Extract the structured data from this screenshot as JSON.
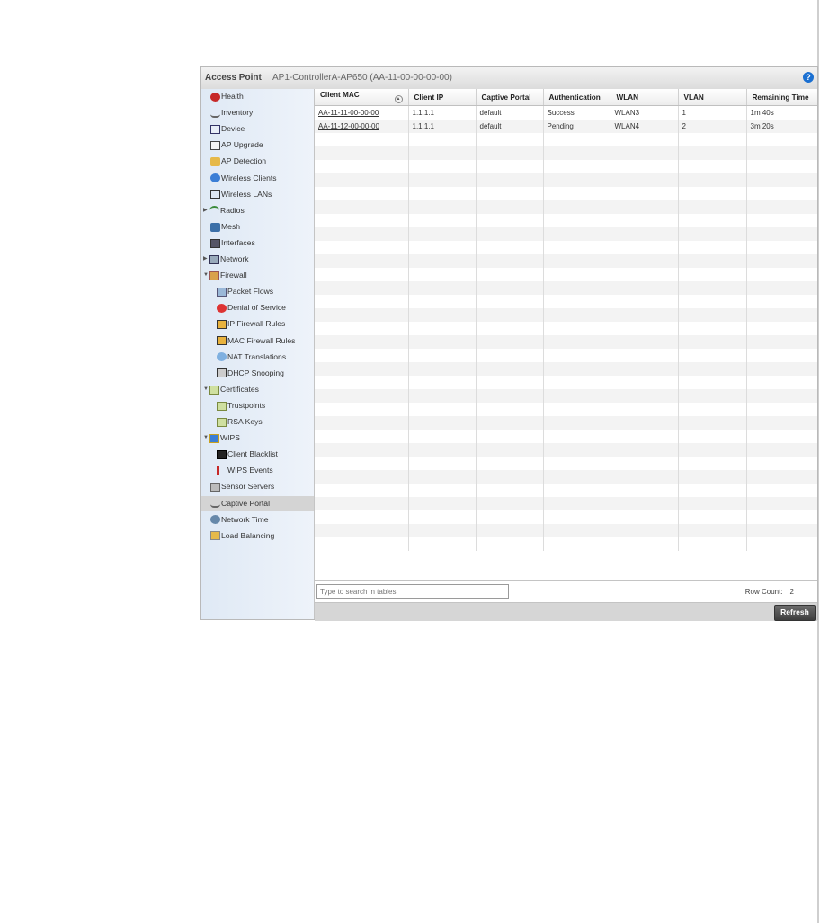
{
  "header": {
    "title": "Access Point",
    "subtitle": "AP1-ControllerA-AP650 (AA-11-00-00-00-00)",
    "help": "?"
  },
  "sidebar": {
    "items": [
      {
        "label": "Health",
        "icon": "health-icon",
        "indent": 0
      },
      {
        "label": "Inventory",
        "icon": "inventory-icon",
        "indent": 0
      },
      {
        "label": "Device",
        "icon": "device-icon",
        "indent": 0
      },
      {
        "label": "AP Upgrade",
        "icon": "ap-upgrade-icon",
        "indent": 0
      },
      {
        "label": "AP Detection",
        "icon": "ap-detection-icon",
        "indent": 0
      },
      {
        "label": "Wireless Clients",
        "icon": "wireless-clients-icon",
        "indent": 0
      },
      {
        "label": "Wireless LANs",
        "icon": "wireless-lans-icon",
        "indent": 0
      },
      {
        "label": "Radios",
        "icon": "radios-icon",
        "indent": 0,
        "arrow": "▶"
      },
      {
        "label": "Mesh",
        "icon": "mesh-icon",
        "indent": 0
      },
      {
        "label": "Interfaces",
        "icon": "interfaces-icon",
        "indent": 0
      },
      {
        "label": "Network",
        "icon": "network-icon",
        "indent": 0,
        "arrow": "▶"
      },
      {
        "label": "Firewall",
        "icon": "firewall-icon",
        "indent": 0,
        "arrow": "▼"
      },
      {
        "label": "Packet Flows",
        "icon": "packet-flows-icon",
        "indent": 1
      },
      {
        "label": "Denial of Service",
        "icon": "denial-of-service-icon",
        "indent": 1
      },
      {
        "label": "IP Firewall Rules",
        "icon": "ip-firewall-rules-icon",
        "indent": 1
      },
      {
        "label": "MAC Firewall Rules",
        "icon": "mac-firewall-rules-icon",
        "indent": 1
      },
      {
        "label": "NAT Translations",
        "icon": "nat-translations-icon",
        "indent": 1
      },
      {
        "label": "DHCP Snooping",
        "icon": "dhcp-snooping-icon",
        "indent": 1
      },
      {
        "label": "Certificates",
        "icon": "certificates-icon",
        "indent": 0,
        "arrow": "▼"
      },
      {
        "label": "Trustpoints",
        "icon": "trustpoints-icon",
        "indent": 1
      },
      {
        "label": "RSA Keys",
        "icon": "rsa-keys-icon",
        "indent": 1
      },
      {
        "label": "WIPS",
        "icon": "wips-icon",
        "indent": 0,
        "arrow": "▼"
      },
      {
        "label": "Client Blacklist",
        "icon": "client-blacklist-icon",
        "indent": 1
      },
      {
        "label": "WIPS Events",
        "icon": "wips-events-icon",
        "indent": 1
      },
      {
        "label": "Sensor Servers",
        "icon": "sensor-servers-icon",
        "indent": 0
      },
      {
        "label": "Captive Portal",
        "icon": "captive-portal-icon",
        "indent": 0,
        "active": true
      },
      {
        "label": "Network Time",
        "icon": "network-time-icon",
        "indent": 0
      },
      {
        "label": "Load Balancing",
        "icon": "load-balancing-icon",
        "indent": 0
      }
    ]
  },
  "table": {
    "columns": [
      "Client MAC",
      "Client IP",
      "Captive Portal",
      "Authentication",
      "WLAN",
      "VLAN",
      "Remaining Time"
    ],
    "rows": [
      [
        "AA-11-11-00-00-00",
        "1.1.1.1",
        "default",
        "Success",
        "WLAN3",
        "1",
        "1m 40s"
      ],
      [
        "AA-11-12-00-00-00",
        "1.1.1.1",
        "default",
        "Pending",
        "WLAN4",
        "2",
        "3m 20s"
      ]
    ]
  },
  "footer": {
    "search_placeholder": "Type to search in tables",
    "row_count_label": "Row Count:",
    "row_count": "2",
    "refresh_label": "Refresh"
  }
}
